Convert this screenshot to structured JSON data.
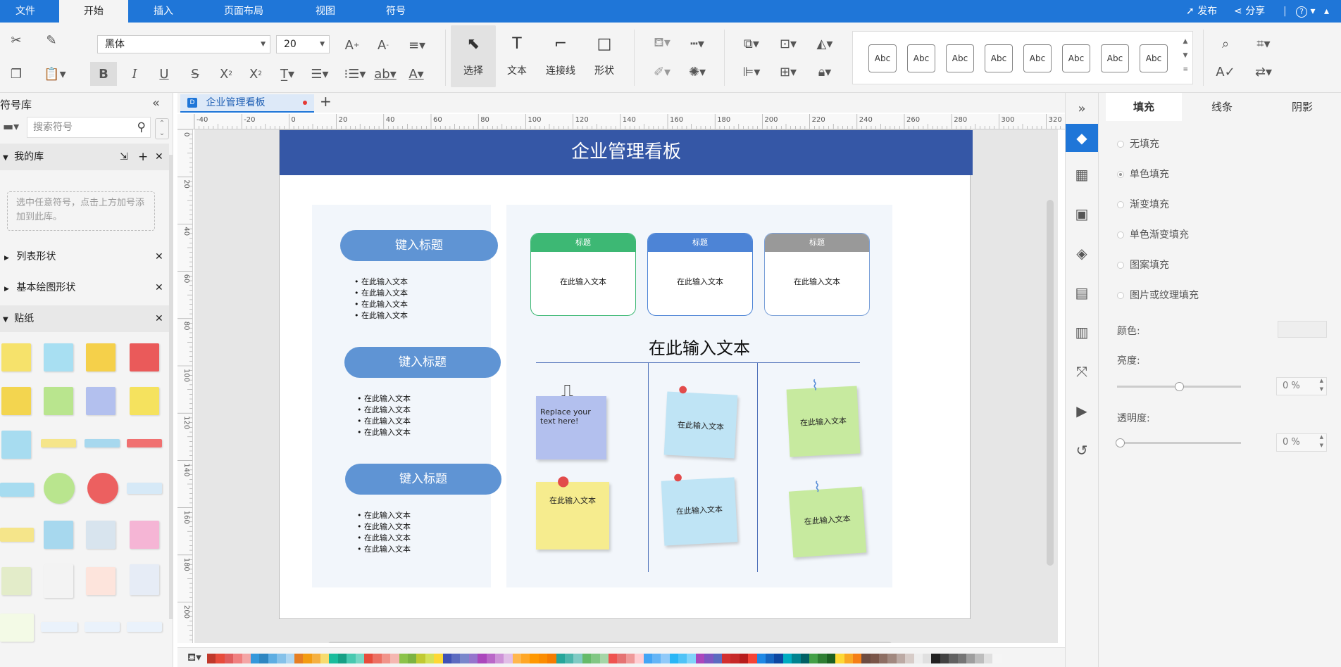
{
  "menu": {
    "items": [
      "文件",
      "开始",
      "插入",
      "页面布局",
      "视图",
      "符号"
    ],
    "publish": "发布",
    "share": "分享",
    "help": "?"
  },
  "ribbon": {
    "font": "黑体",
    "size": "20",
    "select_label": "选择",
    "text_label": "文本",
    "connector_label": "连接线",
    "shape_label": "形状",
    "style_samples": [
      "Abc",
      "Abc",
      "Abc",
      "Abc",
      "Abc",
      "Abc",
      "Abc",
      "Abc"
    ]
  },
  "library": {
    "title": "符号库",
    "search_placeholder": "搜索符号",
    "my_library": "我的库",
    "hint": "选中任意符号，点击上方加号添加到此库。",
    "sections": [
      "列表形状",
      "基本绘图形状",
      "贴纸"
    ]
  },
  "document": {
    "tab_name": "企业管理看板"
  },
  "ruler": {
    "h": [
      "-40",
      "-20",
      "0",
      "20",
      "40",
      "60",
      "80",
      "100",
      "120",
      "140",
      "160",
      "180",
      "200",
      "220",
      "240",
      "260",
      "280",
      "300",
      "320"
    ],
    "v": [
      "0",
      "20",
      "40",
      "60",
      "80",
      "100",
      "120",
      "140",
      "160",
      "180",
      "200"
    ]
  },
  "board": {
    "title": "企业管理看板",
    "pills": [
      "键入标题",
      "键入标题",
      "键入标题"
    ],
    "bullet_text": "在此输入文本",
    "cards": [
      {
        "header": "标题",
        "body": "在此输入文本",
        "color": "#3db874"
      },
      {
        "header": "标题",
        "body": "在此输入文本",
        "color": "#4d84d6"
      },
      {
        "header": "标题",
        "body": "在此输入文本",
        "color": "#999999"
      }
    ],
    "subtitle": "在此输入文本",
    "notes": [
      "Replace your text here!",
      "在此输入文本",
      "在此输入文本",
      "在此输入文本",
      "在此输入文本",
      "在此输入文本"
    ]
  },
  "format_panel": {
    "tabs": [
      "填充",
      "线条",
      "阴影"
    ],
    "options": [
      "无填充",
      "单色填充",
      "渐变填充",
      "单色渐变填充",
      "图案填充",
      "图片或纹理填充"
    ],
    "color_label": "颜色:",
    "brightness_label": "亮度:",
    "brightness_value": "0 %",
    "transparency_label": "透明度:",
    "transparency_value": "0 %"
  },
  "palette": [
    "#c0392b",
    "#e74c3c",
    "#e05e5e",
    "#f08080",
    "#f4a6a6",
    "#3498db",
    "#2e86c1",
    "#5dade2",
    "#85c1e9",
    "#aed6f1",
    "#e67e22",
    "#f39c12",
    "#f5b041",
    "#f7dc6f",
    "#1abc9c",
    "#16a085",
    "#48c9b0",
    "#76d7c4",
    "#e74c3c",
    "#ec7063",
    "#f1948a",
    "#f5b7b1",
    "#8bc34a",
    "#7cb342",
    "#c0ca33",
    "#d4e157",
    "#fdd835",
    "#3f51b5",
    "#5c6bc0",
    "#7986cb",
    "#9575cd",
    "#ab47bc",
    "#ba68c8",
    "#ce93d8",
    "#e1bee7",
    "#ffb74d",
    "#ffa726",
    "#ff9800",
    "#fb8c00",
    "#f57c00",
    "#26a69a",
    "#4db6ac",
    "#80cbc4",
    "#66bb6a",
    "#81c784",
    "#a5d6a7",
    "#ef5350",
    "#e57373",
    "#ef9a9a",
    "#ffcdd2",
    "#42a5f5",
    "#64b5f6",
    "#90caf9",
    "#29b6f6",
    "#4fc3f7",
    "#81d4fa",
    "#ab47bc",
    "#7e57c2",
    "#5c6bc0",
    "#d32f2f",
    "#c62828",
    "#b71c1c",
    "#f44336",
    "#1e88e5",
    "#1565c0",
    "#0d47a1",
    "#00acc1",
    "#00838f",
    "#006064",
    "#43a047",
    "#2e7d32",
    "#1b5e20",
    "#fdd835",
    "#f9a825",
    "#f57f17",
    "#6d4c41",
    "#795548",
    "#8d6e63",
    "#a1887f",
    "#bcaaa4",
    "#d7ccc8",
    "#eeeeee",
    "#e0e0e0",
    "#212121",
    "#424242",
    "#616161",
    "#757575",
    "#9e9e9e",
    "#bdbdbd",
    "#e0e0e0",
    "#f5f5f5"
  ]
}
